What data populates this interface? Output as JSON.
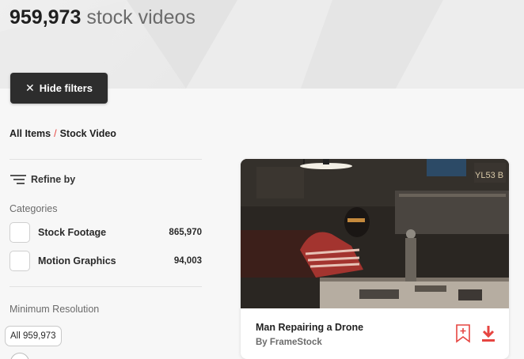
{
  "hero": {
    "count": "959,973",
    "label": "stock videos"
  },
  "filters_toggle": {
    "icon": "close-icon",
    "label": "Hide filters"
  },
  "breadcrumb": {
    "root": "All Items",
    "separator": "/",
    "current": "Stock Video"
  },
  "refine": {
    "icon": "filter-lines-icon",
    "label": "Refine by"
  },
  "categories": {
    "heading": "Categories",
    "items": [
      {
        "label": "Stock Footage",
        "count": "865,970"
      },
      {
        "label": "Motion Graphics",
        "count": "94,003"
      }
    ]
  },
  "resolution": {
    "heading": "Minimum Resolution",
    "tooltip": "All 959,973"
  },
  "card": {
    "title": "Man Repairing a Drone",
    "author_prefix": "By",
    "author": "FrameStock",
    "bookmark_icon": "bookmark-plus-icon",
    "download_icon": "download-icon"
  },
  "colors": {
    "accent": "#e64541",
    "button_dark": "#2d2d2d"
  }
}
